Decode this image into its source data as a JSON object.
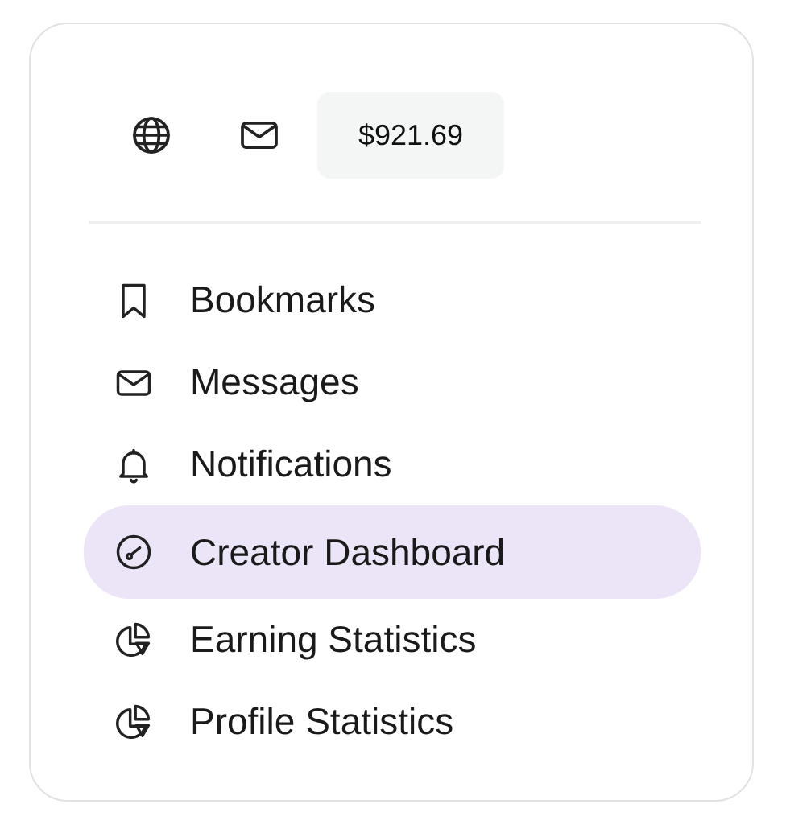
{
  "header": {
    "balance": "$921.69"
  },
  "menu": [
    {
      "kind": "bookmark",
      "label": "Bookmarks",
      "selected": false
    },
    {
      "kind": "mail",
      "label": "Messages",
      "selected": false
    },
    {
      "kind": "bell",
      "label": "Notifications",
      "selected": false
    },
    {
      "kind": "gauge",
      "label": "Creator Dashboard",
      "selected": true
    },
    {
      "kind": "pie",
      "label": "Earning Statistics",
      "selected": false
    },
    {
      "kind": "pie",
      "label": "Profile Statistics",
      "selected": false
    }
  ]
}
